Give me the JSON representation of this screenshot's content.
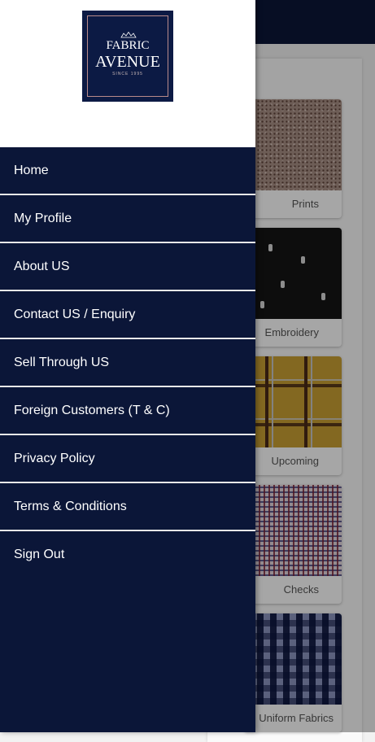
{
  "brand": {
    "line1": "FABRIC",
    "line2": "AVENUE",
    "tagline": "SINCE 1995"
  },
  "menu": [
    "Home",
    "My Profile",
    "About US",
    "Contact US / Enquiry",
    "Sell Through US",
    "Foreign Customers (T & C)",
    "Privacy Policy",
    "Terms & Conditions",
    "Sign Out"
  ],
  "categories": [
    "Prints",
    "Embroidery",
    "Upcoming",
    "Checks",
    "Uniform Fabrics"
  ],
  "colors": {
    "drawer_bg": "#0b1638",
    "divider": "#e8e8e8",
    "header_bg": "#0b1638"
  },
  "icons": {
    "logo": "fabric-avenue-crown-logo"
  }
}
